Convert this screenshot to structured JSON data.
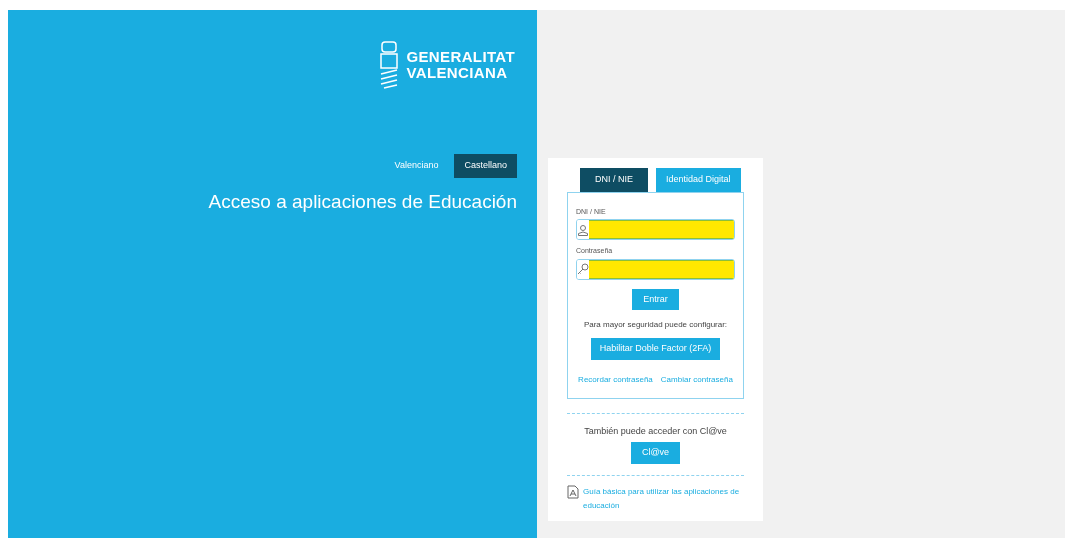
{
  "brand": {
    "line_1": "GENERALITAT",
    "line_2": "VALENCIANA"
  },
  "languages": [
    {
      "label": "Valenciano",
      "selected": false
    },
    {
      "label": "Castellano",
      "selected": true
    }
  ],
  "heading": "Acceso a aplicaciones de Educación",
  "tabs": [
    {
      "label": "DNI / NIE",
      "selected": true
    },
    {
      "label": "Identidad Digital",
      "selected": false
    }
  ],
  "fields": [
    {
      "label": "DNI / NIE",
      "kind": "user",
      "highlighted": true
    },
    {
      "label": "Contraseña",
      "kind": "password",
      "highlighted": true
    }
  ],
  "submit_button": "Entrar",
  "security_note": "Para mayor seguridad puede configurar:",
  "two_factor_button": "Habilitar Doble Factor (2FA)",
  "links": [
    "Recordar contraseña",
    "Cambiar contraseña"
  ],
  "clave_note": "También puede acceder con Cl@ve",
  "clave_button": "Cl@ve",
  "guide_link": "Guía básica para utilizar las aplicaciones de educación"
}
